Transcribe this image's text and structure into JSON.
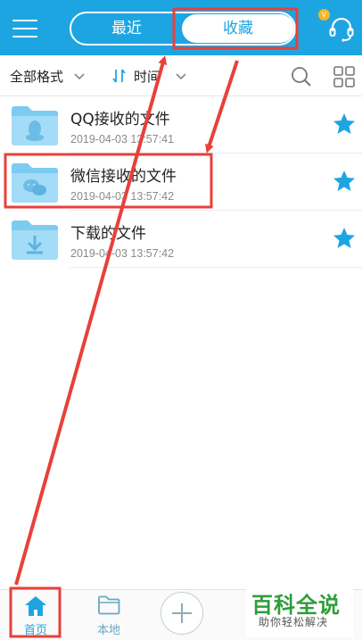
{
  "header": {
    "tabs": [
      {
        "label": "最近",
        "active": false
      },
      {
        "label": "收藏",
        "active": true
      }
    ],
    "vip_badge": "V",
    "icons": {
      "menu": "menu-icon",
      "support": "headset-icon"
    }
  },
  "filter_bar": {
    "format_label": "全部格式",
    "sort_label": "时间",
    "icons": {
      "sort": "sort-icon",
      "search": "search-icon",
      "view": "grid-view-icon"
    }
  },
  "files": [
    {
      "name": "QQ接收的文件",
      "date": "2019-04-03 13:57:41",
      "icon": "qq-folder-icon",
      "starred": true
    },
    {
      "name": "微信接收的文件",
      "date": "2019-04-03 13:57:42",
      "icon": "wechat-folder-icon",
      "starred": true
    },
    {
      "name": "下载的文件",
      "date": "2019-04-03 13:57:42",
      "icon": "download-folder-icon",
      "starred": true
    }
  ],
  "bottom_nav": {
    "items": [
      {
        "label": "首页",
        "icon": "home-icon",
        "active": true
      },
      {
        "label": "本地",
        "icon": "folder-icon",
        "active": false
      }
    ],
    "add_icon": "plus-icon"
  },
  "watermark": {
    "title": "百科全说",
    "subtitle": "助你轻松解决"
  },
  "colors": {
    "brand": "#1da5e2",
    "star": "#1da5e2",
    "folder": "#8fd3f4",
    "annotation": "#e8403a"
  }
}
